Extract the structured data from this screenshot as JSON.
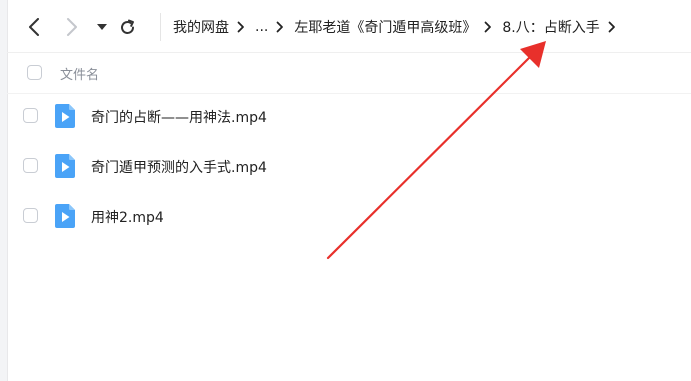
{
  "toolbar": {
    "back_icon": "chevron-left-icon",
    "forward_icon": "chevron-right-icon",
    "dropdown_icon": "caret-down-icon",
    "refresh_icon": "refresh-icon"
  },
  "breadcrumb": {
    "items": [
      {
        "label": "我的网盘"
      },
      {
        "label": "..."
      },
      {
        "label": "左耶老道《奇门遁甲高级班》"
      },
      {
        "label": "8.八：占断入手"
      }
    ]
  },
  "list": {
    "column_header": "文件名",
    "files": [
      {
        "name": "奇门的占断——用神法.mp4",
        "type": "video"
      },
      {
        "name": "奇门遁甲预测的入手式.mp4",
        "type": "video"
      },
      {
        "name": "用神2.mp4",
        "type": "video"
      }
    ]
  },
  "colors": {
    "video_icon": "#4aa3f7",
    "annotation_arrow": "#e8302b",
    "text_primary": "#222222",
    "text_secondary": "#8a8f99"
  }
}
